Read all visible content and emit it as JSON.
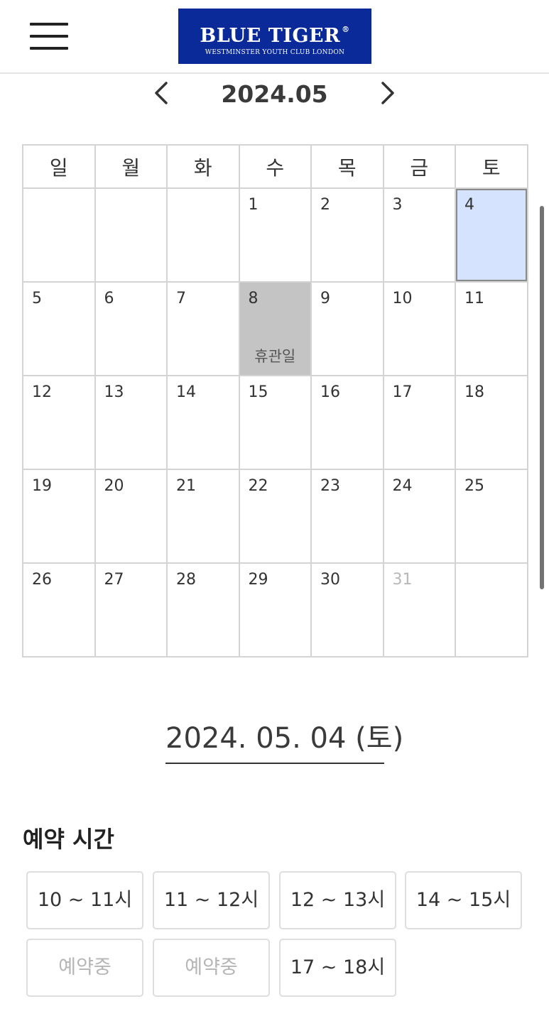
{
  "header": {
    "logo_main": "BLUE TIGER",
    "logo_mark": "®",
    "logo_sub": "WESTMINSTER YOUTH CLUB LONDON"
  },
  "calendar": {
    "month_label": "2024.05",
    "weekdays": [
      "일",
      "월",
      "화",
      "수",
      "목",
      "금",
      "토"
    ],
    "weeks": [
      [
        "",
        "",
        "",
        "1",
        "2",
        "3",
        "4"
      ],
      [
        "5",
        "6",
        "7",
        "8",
        "9",
        "10",
        "11"
      ],
      [
        "12",
        "13",
        "14",
        "15",
        "16",
        "17",
        "18"
      ],
      [
        "19",
        "20",
        "21",
        "22",
        "23",
        "24",
        "25"
      ],
      [
        "26",
        "27",
        "28",
        "29",
        "30",
        "31",
        ""
      ]
    ],
    "closed_label": "휴관일",
    "closed_day": "8",
    "selected_day": "4",
    "muted_day": "31",
    "colors": {
      "selected_bg": "#d6e3ff",
      "closed_bg": "#c4c4c4",
      "brand": "#0a2a9a"
    }
  },
  "selected_date": "2024. 05. 04 (토)",
  "reservation": {
    "title": "예약 시간",
    "slots": [
      {
        "label": "10 ~ 11시",
        "available": true
      },
      {
        "label": "11 ~ 12시",
        "available": true
      },
      {
        "label": "12 ~ 13시",
        "available": true
      },
      {
        "label": "14 ~ 15시",
        "available": true
      },
      {
        "label": "예약중",
        "available": false
      },
      {
        "label": "예약중",
        "available": false
      },
      {
        "label": "17 ~ 18시",
        "available": true
      }
    ]
  },
  "icons": {
    "menu": "hamburger-menu-icon",
    "prev": "chevron-left-icon",
    "next": "chevron-right-icon"
  }
}
